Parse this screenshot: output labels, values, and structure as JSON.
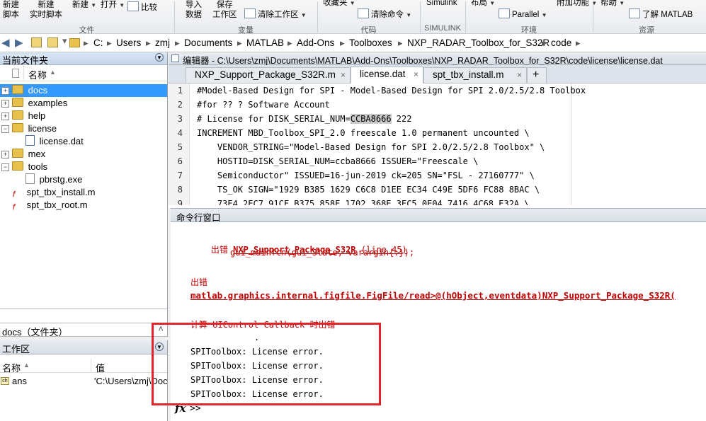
{
  "ribbon": {
    "buttons": [
      {
        "label": "新建\n脚本"
      },
      {
        "label": "新建\n实时脚本"
      },
      {
        "label": "新建"
      },
      {
        "label": "打开"
      },
      {
        "label": "比较"
      },
      {
        "label": "导入\n数据"
      },
      {
        "label": "保存\n工作区"
      },
      {
        "label": "清除工作区"
      },
      {
        "label": "收藏夹"
      },
      {
        "label": "清除命令"
      },
      {
        "label": "Simulink"
      },
      {
        "label": "布局"
      },
      {
        "label": "Parallel"
      },
      {
        "label": "附加功能"
      },
      {
        "label": "帮助"
      },
      {
        "label": "了解 MATLAB"
      }
    ],
    "groups": [
      "文件",
      "变量",
      "代码",
      "SIMULINK",
      "环境",
      "资源"
    ]
  },
  "address": {
    "crumbs": [
      "C:",
      "Users",
      "zmj",
      "Documents",
      "MATLAB",
      "Add-Ons",
      "Toolboxes",
      "NXP_RADAR_Toolbox_for_S32R",
      "code"
    ]
  },
  "current_folder": {
    "title": "当前文件夹",
    "col_name": "名称",
    "items": [
      {
        "name": "docs",
        "type": "folder"
      },
      {
        "name": "examples",
        "type": "folder"
      },
      {
        "name": "help",
        "type": "folder"
      },
      {
        "name": "license",
        "type": "folder"
      },
      {
        "name": "license.dat",
        "type": "dat"
      },
      {
        "name": "mex",
        "type": "folder"
      },
      {
        "name": "tools",
        "type": "folder"
      },
      {
        "name": "pbrstg.exe",
        "type": "exe"
      },
      {
        "name": "spt_tbx_install.m",
        "type": "m"
      },
      {
        "name": "spt_tbx_root.m",
        "type": "m"
      }
    ],
    "details": "docs（文件夹）"
  },
  "workspace": {
    "title": "工作区",
    "col_name": "名称",
    "col_value": "值",
    "rows": [
      {
        "name": "ans",
        "value": "'C:\\Users\\zmj\\Doc"
      }
    ]
  },
  "editor": {
    "title": "编辑器 - C:\\Users\\zmj\\Documents\\MATLAB\\Add-Ons\\Toolboxes\\NXP_RADAR_Toolbox_for_S32R\\code\\license\\license.dat",
    "tabs": [
      "NXP_Support_Package_S32R.m",
      "license.dat",
      "spt_tbx_install.m"
    ],
    "active_tab": 1,
    "lines": [
      {
        "n": "1",
        "text": "#Model-Based Design for SPI - Model-Based Design for SPI 2.0/2.5/2.8 Toolbox"
      },
      {
        "n": "2",
        "text": "#for ?? ? Software Account"
      },
      {
        "n": "3",
        "pre": "# License for DISK_SERIAL_NUM=",
        "hl": "CCBA8666",
        "post": " 222"
      },
      {
        "n": "4",
        "text": "INCREMENT MBD_Toolbox_SPI_2.0 freescale 1.0 permanent uncounted \\"
      },
      {
        "n": "5",
        "text": "    VENDOR_STRING=\"Model-Based Design for SPI 2.0/2.5/2.8 Toolbox\" \\"
      },
      {
        "n": "6",
        "text": "    HOSTID=DISK_SERIAL_NUM=ccba8666 ISSUER=\"Freescale \\"
      },
      {
        "n": "7",
        "text": "    Semiconductor\" ISSUED=16-jun-2019 ck=205 SN=\"FSL - 27160777\" \\"
      },
      {
        "n": "8",
        "text": "    TS_OK SIGN=\"1929 B385 1629 C6C8 D1EE EC34 C49E 5DF6 FC88 8BAC \\"
      },
      {
        "n": "9",
        "text": "    73E4 2EC7 91CF B375 858E 1702 368E 3EC5 0E04 7416 4C68 E32A \\"
      }
    ]
  },
  "command_window": {
    "title": "命令行窗口",
    "err1_prefix": "出错 ",
    "err1_link": "NXP_Support_Package_S32R",
    "err1_line": "(line 45)",
    "err1_code": "gui_mainfcn(gui_State, varargin{:});",
    "err2_prefix": "出错",
    "err2_link": "matlab.graphics.internal.figfile.FigFile/read>@(hObject,eventdata)NXP_Support_Package_S32R(",
    "err3": "计算 UIControl Callback 时出错",
    "dot": ".",
    "messages": [
      "SPIToolbox: License error.",
      "SPIToolbox: License error.",
      "SPIToolbox: License error.",
      "SPIToolbox: License error."
    ],
    "prompt": ">>",
    "fx": "fx"
  },
  "annotation_color": "#e0262b"
}
